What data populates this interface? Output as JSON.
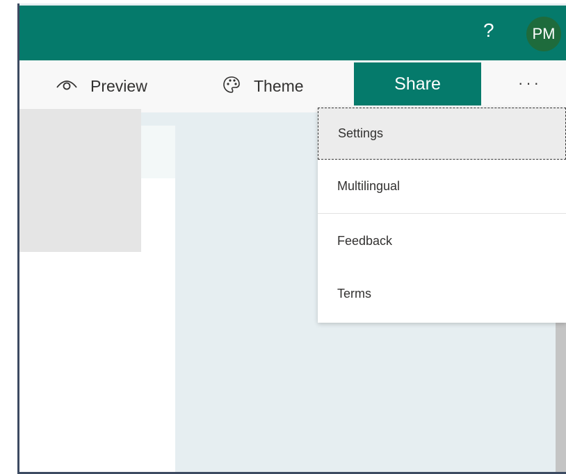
{
  "header": {
    "help_label": "?",
    "avatar_initials": "PM",
    "color": "#057a6b"
  },
  "toolbar": {
    "preview_label": "Preview",
    "theme_label": "Theme",
    "share_label": "Share",
    "more_label": "···"
  },
  "menu": {
    "items": [
      {
        "label": "Settings",
        "selected": true
      },
      {
        "label": "Multilingual"
      },
      {
        "label": "Feedback"
      },
      {
        "label": "Terms"
      }
    ]
  }
}
